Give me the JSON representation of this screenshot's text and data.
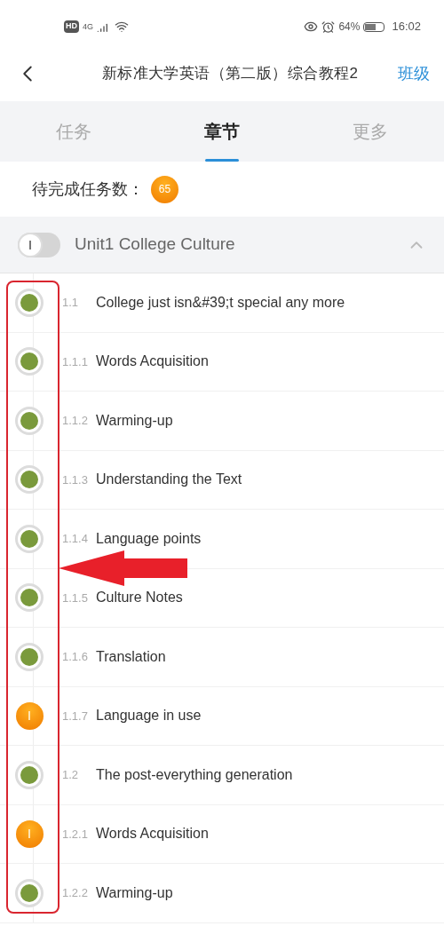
{
  "status_bar": {
    "hd": "HD",
    "network": "4G",
    "battery": "64%",
    "time": "16:02"
  },
  "nav": {
    "title": "新标准大学英语（第二版）综合教程2",
    "action": "班级"
  },
  "tabs": [
    {
      "label": "任务",
      "selected": false
    },
    {
      "label": "章节",
      "selected": true
    },
    {
      "label": "更多",
      "selected": false
    }
  ],
  "pending": {
    "label": "待完成任务数：",
    "count": "65"
  },
  "unit": {
    "title": "Unit1 College Culture",
    "expanded": true,
    "lessons": [
      {
        "number": "1.1",
        "title": "College just isn&#39;t special any more",
        "completed": true
      },
      {
        "number": "1.1.1",
        "title": "Words Acquisition",
        "completed": true
      },
      {
        "number": "1.1.2",
        "title": "Warming-up",
        "completed": true
      },
      {
        "number": "1.1.3",
        "title": "Understanding the Text",
        "completed": true
      },
      {
        "number": "1.1.4",
        "title": "Language points",
        "completed": true
      },
      {
        "number": "1.1.5",
        "title": "Culture Notes",
        "completed": true
      },
      {
        "number": "1.1.6",
        "title": "Translation",
        "completed": true
      },
      {
        "number": "1.1.7",
        "title": "Language in use",
        "completed": false
      },
      {
        "number": "1.2",
        "title": "The post-everything generation",
        "completed": true
      },
      {
        "number": "1.2.1",
        "title": "Words Acquisition",
        "completed": false
      },
      {
        "number": "1.2.2",
        "title": "Warming-up",
        "completed": true
      }
    ]
  }
}
